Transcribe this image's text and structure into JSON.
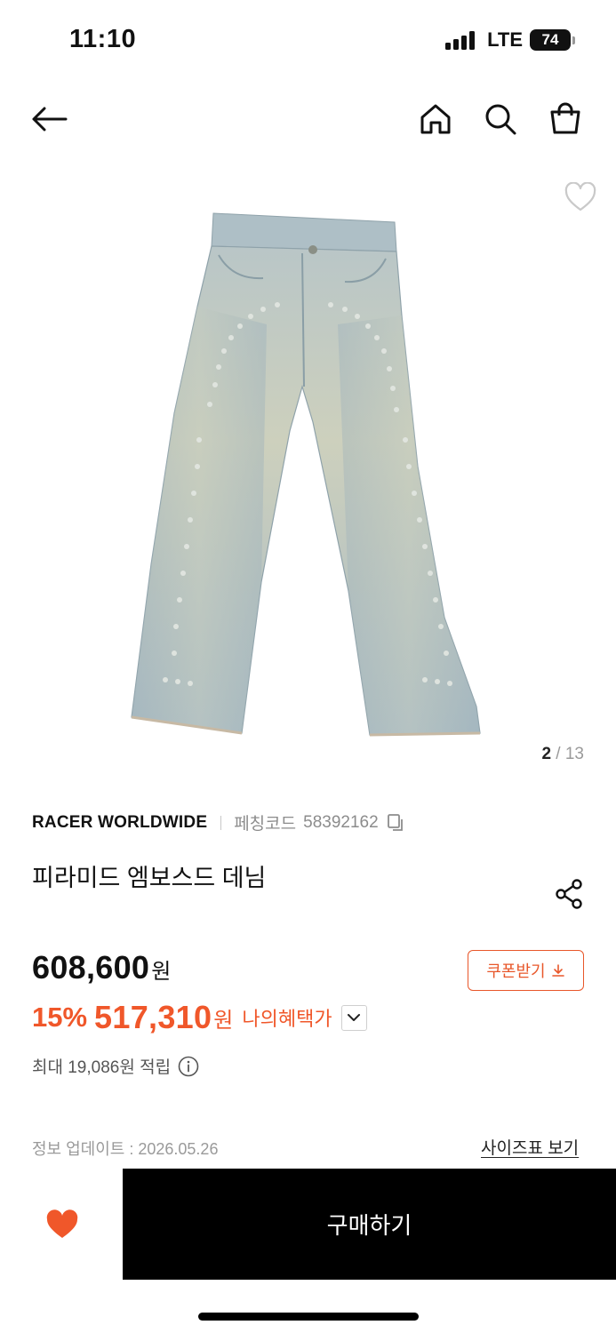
{
  "status": {
    "time": "11:10",
    "network": "LTE",
    "battery": "74"
  },
  "product": {
    "image_index": "2",
    "image_total": "/ 13",
    "brand": "RACER WORLDWIDE",
    "code_label": "페칭코드",
    "code_value": "58392162",
    "name": "피라미드 엠보스드 데님",
    "original_price": "608,600",
    "currency": "원",
    "sale_rate": "15%",
    "sale_price": "517,310",
    "benefit_label": "나의혜택가",
    "points": "최대 19,086원 적립",
    "update_info": "정보 업데이트 : 2026.05.26",
    "size_chart": "사이즈표 보기"
  },
  "actions": {
    "coupon": "쿠폰받기",
    "buy": "구매하기"
  },
  "colors": {
    "accent": "#f0572a",
    "primary": "#000000",
    "denim": "#a9bcc4"
  }
}
